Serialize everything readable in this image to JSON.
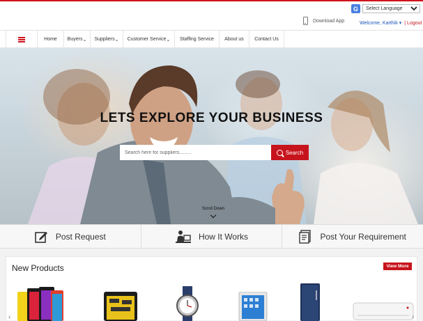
{
  "language": {
    "selected": "Select Language",
    "icon": "google-translate-icon"
  },
  "header": {
    "download_app": "Download App",
    "welcome": "Welcome, Karthik",
    "welcome_caret": "▾",
    "separator": "|",
    "logout": "Logout"
  },
  "nav": {
    "items": [
      {
        "label": "Home"
      },
      {
        "label": "Buyers"
      },
      {
        "label": "Suppliers"
      },
      {
        "label": "Customer Service"
      },
      {
        "label": "Staffing Service"
      },
      {
        "label": "About us"
      },
      {
        "label": "Contact Us"
      }
    ]
  },
  "hero": {
    "title": "LETS EXPLORE YOUR BUSINESS",
    "search_placeholder": "Search here for suppliers.........",
    "search_button": "Search",
    "scroll_down": "Scroll Down"
  },
  "actions": [
    {
      "label": "Post Request",
      "icon": "edit-icon"
    },
    {
      "label": "How It Works",
      "icon": "person-computer-icon"
    },
    {
      "label": "Post Your Requirement",
      "icon": "document-icon"
    }
  ],
  "products": {
    "title": "New Products",
    "view_more": "View More",
    "items": [
      {
        "name": "smartphones"
      },
      {
        "name": "tool-kit"
      },
      {
        "name": "wrist-watch"
      },
      {
        "name": "tablet"
      },
      {
        "name": "refrigerator"
      },
      {
        "name": "air-conditioner"
      }
    ]
  },
  "colors": {
    "accent": "#c7141c",
    "link": "#1a56b8"
  }
}
